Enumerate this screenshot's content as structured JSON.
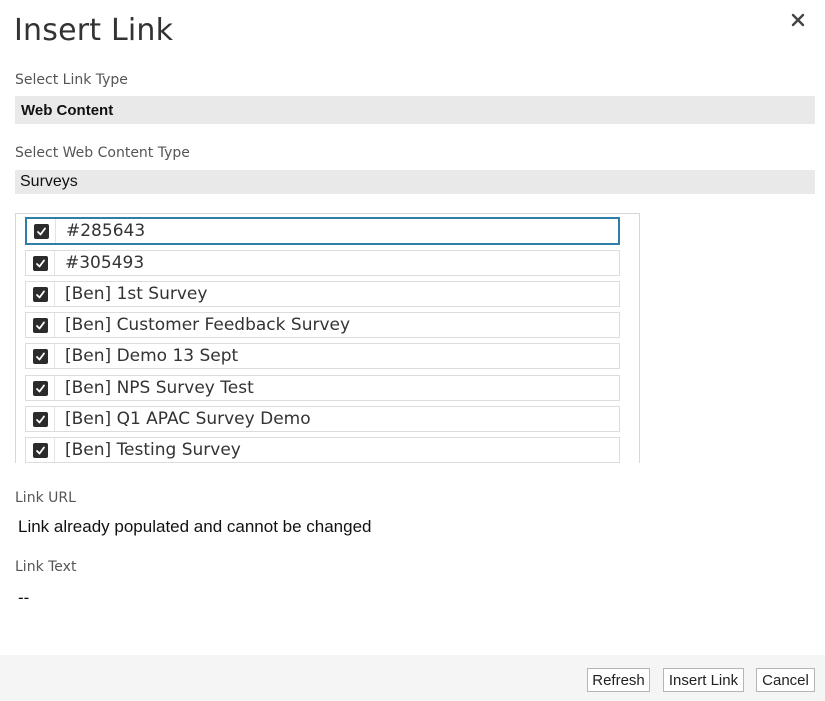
{
  "dialog": {
    "title": "Insert Link",
    "close_icon": "close-icon"
  },
  "link_type": {
    "label": "Select Link Type",
    "value": "Web Content"
  },
  "web_content_type": {
    "label": "Select Web Content Type",
    "value": "Surveys"
  },
  "content_list": {
    "items": [
      {
        "label": "#285643",
        "checked": true
      },
      {
        "label": "#305493",
        "checked": true
      },
      {
        "label": "[Ben] 1st Survey",
        "checked": true
      },
      {
        "label": "[Ben] Customer Feedback Survey",
        "checked": true
      },
      {
        "label": "[Ben] Demo 13 Sept",
        "checked": true
      },
      {
        "label": "[Ben] NPS Survey Test",
        "checked": true
      },
      {
        "label": "[Ben] Q1 APAC Survey Demo",
        "checked": true
      },
      {
        "label": "[Ben] Testing Survey",
        "checked": true
      }
    ]
  },
  "link_url": {
    "label": "Link URL",
    "value": "Link already populated and cannot be changed"
  },
  "link_text": {
    "label": "Link Text",
    "value": "--"
  },
  "footer": {
    "refresh_label": "Refresh",
    "insert_label": "Insert Link",
    "cancel_label": "Cancel"
  },
  "colors": {
    "focus_border": "#2f7ea8",
    "select_background": "#e9e9ea",
    "checkbox": "#2b2b2b"
  }
}
